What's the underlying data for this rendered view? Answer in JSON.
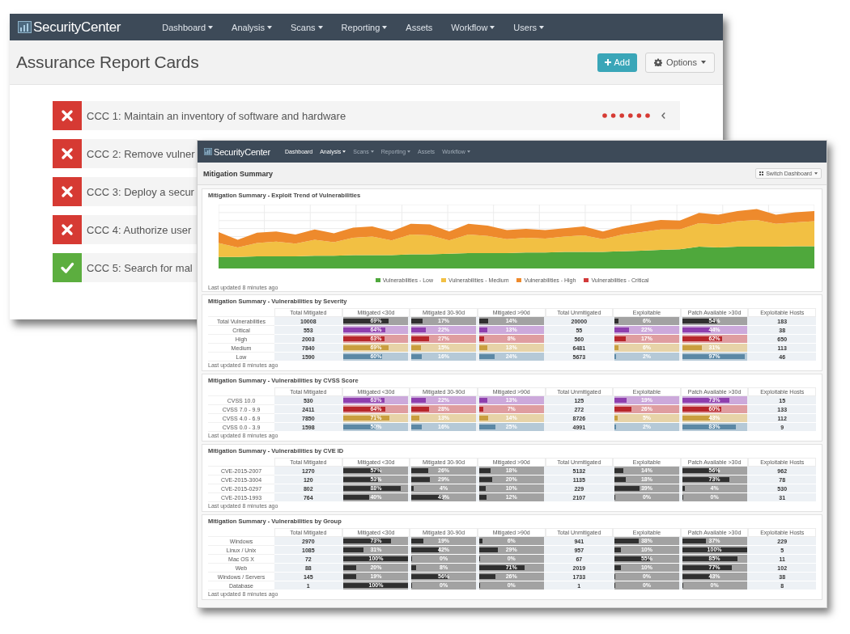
{
  "back_window": {
    "logo": "SecurityCenter",
    "nav": [
      {
        "label": "Dashboard",
        "dropdown": true
      },
      {
        "label": "Analysis",
        "dropdown": true
      },
      {
        "label": "Scans",
        "dropdown": true
      },
      {
        "label": "Reporting",
        "dropdown": true
      },
      {
        "label": "Assets",
        "dropdown": false
      },
      {
        "label": "Workflow",
        "dropdown": true
      },
      {
        "label": "Users",
        "dropdown": true
      }
    ],
    "title": "Assurance Report Cards",
    "buttons": [
      {
        "kind": "add",
        "label": "Add"
      },
      {
        "kind": "options",
        "label": "Options"
      }
    ],
    "cards": [
      {
        "passed": false,
        "label": "CCC 1: Maintain an inventory of software and hardware",
        "history": [
          {
            "passed": false
          },
          {
            "passed": false
          },
          {
            "passed": false
          },
          {
            "passed": false
          },
          {
            "passed": false
          },
          {
            "passed": false
          }
        ]
      },
      {
        "passed": false,
        "label": "CCC 2: Remove vulner"
      },
      {
        "passed": false,
        "label": "CCC 3: Deploy a secur"
      },
      {
        "passed": false,
        "label": "CCC 4: Authorize user"
      },
      {
        "passed": true,
        "label": "CCC 5: Search for mal"
      }
    ]
  },
  "front_window": {
    "logo": "SecurityCenter",
    "nav": [
      {
        "label": "Dashboard",
        "dropdown": false,
        "disabled": false
      },
      {
        "label": "Analysis",
        "dropdown": true,
        "disabled": false
      },
      {
        "label": "Scans",
        "dropdown": true,
        "disabled": true
      },
      {
        "label": "Reporting",
        "dropdown": true,
        "disabled": true
      },
      {
        "label": "Assets",
        "dropdown": false,
        "disabled": true
      },
      {
        "label": "Workflow",
        "dropdown": true,
        "disabled": true
      }
    ],
    "title": "Mitigation Summary",
    "switch_button": "Switch Dashboard",
    "trend_panel": {
      "title": "Mitigation Summary - Exploit Trend of Vulnerabilities",
      "legend": [
        {
          "label": "Vulnerabilities - Low",
          "color": "#4fa83c"
        },
        {
          "label": "Vulnerabilities - Medium",
          "color": "#f2c043"
        },
        {
          "label": "Vulnerabilities - High",
          "color": "#ee8a2c"
        },
        {
          "label": "Vulnerabilities - Critical",
          "color": "#d23a3a"
        }
      ],
      "footer": "Last updated 8 minutes ago"
    },
    "tables": [
      {
        "title": "Mitigation Summary - Vulnerabilities by Severity",
        "columns": [
          {
            "label": "Total Mitigated",
            "kind": "number"
          },
          {
            "label": "Mitigated <30d",
            "kind": "bar"
          },
          {
            "label": "Mitigated 30-90d",
            "kind": "bar"
          },
          {
            "label": "Mitigated >90d",
            "kind": "bar"
          },
          {
            "label": "Total Unmitigated",
            "kind": "number"
          },
          {
            "label": "Exploitable",
            "kind": "bar"
          },
          {
            "label": "Patch Available >30d",
            "kind": "bar"
          },
          {
            "label": "Exploitable Hosts",
            "kind": "number"
          }
        ],
        "rows": [
          {
            "label": "Total Vulnerabilities",
            "color": "#303030",
            "cells": [
              {
                "text": "10008"
              },
              {
                "text": "69%",
                "level": 0.69
              },
              {
                "text": "17%",
                "level": 0.17
              },
              {
                "text": "14%",
                "level": 0.14
              },
              {
                "text": "20000"
              },
              {
                "text": "6%",
                "level": 0.06
              },
              {
                "text": "54%",
                "level": 0.54
              },
              {
                "text": "183"
              }
            ]
          },
          {
            "label": "Critical",
            "color": "#8e3fae",
            "cells": [
              {
                "text": "553"
              },
              {
                "text": "64%",
                "level": 0.64
              },
              {
                "text": "22%",
                "level": 0.22
              },
              {
                "text": "13%",
                "level": 0.13
              },
              {
                "text": "55"
              },
              {
                "text": "22%",
                "level": 0.22
              },
              {
                "text": "44%",
                "level": 0.44
              },
              {
                "text": "38"
              }
            ]
          },
          {
            "label": "High",
            "color": "#b8262b",
            "cells": [
              {
                "text": "2003"
              },
              {
                "text": "63%",
                "level": 0.63
              },
              {
                "text": "27%",
                "level": 0.27
              },
              {
                "text": "8%",
                "level": 0.08
              },
              {
                "text": "560"
              },
              {
                "text": "17%",
                "level": 0.17
              },
              {
                "text": "62%",
                "level": 0.62
              },
              {
                "text": "650"
              }
            ]
          },
          {
            "label": "Medium",
            "color": "#c99e3e",
            "cells": [
              {
                "text": "7840"
              },
              {
                "text": "69%",
                "level": 0.69
              },
              {
                "text": "15%",
                "level": 0.15
              },
              {
                "text": "13%",
                "level": 0.13
              },
              {
                "text": "6481"
              },
              {
                "text": "6%",
                "level": 0.06
              },
              {
                "text": "31%",
                "level": 0.31
              },
              {
                "text": "113"
              }
            ]
          },
          {
            "label": "Low",
            "color": "#5b88a5",
            "cells": [
              {
                "text": "1590"
              },
              {
                "text": "60%",
                "level": 0.6
              },
              {
                "text": "16%",
                "level": 0.16
              },
              {
                "text": "24%",
                "level": 0.24
              },
              {
                "text": "5673"
              },
              {
                "text": "2%",
                "level": 0.02
              },
              {
                "text": "97%",
                "level": 0.97
              },
              {
                "text": "46"
              }
            ]
          }
        ],
        "footer": "Last updated 8 minutes ago"
      },
      {
        "title": "Mitigation Summary - Vulnerabilities by CVSS Score",
        "columns": [
          {
            "label": "Total Mitigated",
            "kind": "number"
          },
          {
            "label": "Mitigated <30d",
            "kind": "bar"
          },
          {
            "label": "Mitigated 30-90d",
            "kind": "bar"
          },
          {
            "label": "Mitigated >90d",
            "kind": "bar"
          },
          {
            "label": "Total Unmitigated",
            "kind": "number"
          },
          {
            "label": "Exploitable",
            "kind": "bar"
          },
          {
            "label": "Patch Available >30d",
            "kind": "bar"
          },
          {
            "label": "Exploitable Hosts",
            "kind": "number"
          }
        ],
        "rows": [
          {
            "label": "CVSS 10.0",
            "color": "#8e3fae",
            "cells": [
              {
                "text": "530"
              },
              {
                "text": "63%",
                "level": 0.63
              },
              {
                "text": "22%",
                "level": 0.22
              },
              {
                "text": "13%",
                "level": 0.13
              },
              {
                "text": "125"
              },
              {
                "text": "19%",
                "level": 0.19
              },
              {
                "text": "73%",
                "level": 0.73
              },
              {
                "text": "15"
              }
            ]
          },
          {
            "label": "CVSS 7.0 - 9.9",
            "color": "#b8262b",
            "cells": [
              {
                "text": "2411"
              },
              {
                "text": "64%",
                "level": 0.64
              },
              {
                "text": "28%",
                "level": 0.28
              },
              {
                "text": "7%",
                "level": 0.07
              },
              {
                "text": "272"
              },
              {
                "text": "26%",
                "level": 0.26
              },
              {
                "text": "60%",
                "level": 0.6
              },
              {
                "text": "133"
              }
            ]
          },
          {
            "label": "CVSS 4.0 - 6.9",
            "color": "#c99e3e",
            "cells": [
              {
                "text": "7850"
              },
              {
                "text": "71%",
                "level": 0.71
              },
              {
                "text": "13%",
                "level": 0.13
              },
              {
                "text": "14%",
                "level": 0.14
              },
              {
                "text": "8726"
              },
              {
                "text": "5%",
                "level": 0.05
              },
              {
                "text": "43%",
                "level": 0.43
              },
              {
                "text": "112"
              }
            ]
          },
          {
            "label": "CVSS 0.0 - 3.9",
            "color": "#5b88a5",
            "cells": [
              {
                "text": "1598"
              },
              {
                "text": "50%",
                "level": 0.5
              },
              {
                "text": "16%",
                "level": 0.16
              },
              {
                "text": "25%",
                "level": 0.25
              },
              {
                "text": "4991"
              },
              {
                "text": "2%",
                "level": 0.02
              },
              {
                "text": "83%",
                "level": 0.83
              },
              {
                "text": "9"
              }
            ]
          }
        ],
        "footer": "Last updated 8 minutes ago"
      },
      {
        "title": "Mitigation Summary - Vulnerabilities by CVE ID",
        "columns": [
          {
            "label": "Total Mitigated",
            "kind": "number"
          },
          {
            "label": "Mitigated <30d",
            "kind": "bar"
          },
          {
            "label": "Mitigated 30-90d",
            "kind": "bar"
          },
          {
            "label": "Mitigated >90d",
            "kind": "bar"
          },
          {
            "label": "Total Unmitigated",
            "kind": "number"
          },
          {
            "label": "Exploitable",
            "kind": "bar"
          },
          {
            "label": "Patch Available >30d",
            "kind": "bar"
          },
          {
            "label": "Exploitable Hosts",
            "kind": "number"
          }
        ],
        "rows": [
          {
            "label": "CVE-2015-2007",
            "cells": [
              {
                "text": "1270"
              },
              {
                "text": "57%",
                "level": 0.57
              },
              {
                "text": "26%",
                "level": 0.26
              },
              {
                "text": "18%",
                "level": 0.18
              },
              {
                "text": "5132"
              },
              {
                "text": "14%",
                "level": 0.14
              },
              {
                "text": "56%",
                "level": 0.56
              },
              {
                "text": "962"
              }
            ]
          },
          {
            "label": "CVE-2015-3004",
            "cells": [
              {
                "text": "120"
              },
              {
                "text": "53%",
                "level": 0.53
              },
              {
                "text": "29%",
                "level": 0.29
              },
              {
                "text": "20%",
                "level": 0.2
              },
              {
                "text": "1135"
              },
              {
                "text": "18%",
                "level": 0.18
              },
              {
                "text": "73%",
                "level": 0.73
              },
              {
                "text": "78"
              }
            ]
          },
          {
            "label": "CVE-2015-0297",
            "cells": [
              {
                "text": "802"
              },
              {
                "text": "88%",
                "level": 0.88
              },
              {
                "text": "4%",
                "level": 0.04
              },
              {
                "text": "10%",
                "level": 0.1
              },
              {
                "text": "229"
              },
              {
                "text": "39%",
                "level": 0.39
              },
              {
                "text": "4%",
                "level": 0.04
              },
              {
                "text": "530"
              }
            ]
          },
          {
            "label": "CVE-2015-1993",
            "cells": [
              {
                "text": "764"
              },
              {
                "text": "40%",
                "level": 0.4
              },
              {
                "text": "49%",
                "level": 0.49
              },
              {
                "text": "12%",
                "level": 0.12
              },
              {
                "text": "2107"
              },
              {
                "text": "0%",
                "level": 0
              },
              {
                "text": "0%",
                "level": 0
              },
              {
                "text": "31"
              }
            ]
          }
        ],
        "footer": "Last updated 8 minutes ago"
      },
      {
        "title": "Mitigation Summary - Vulnerabilities by Group",
        "columns": [
          {
            "label": "Total Mitigated",
            "kind": "number"
          },
          {
            "label": "Mitigated <30d",
            "kind": "bar"
          },
          {
            "label": "Mitigated 30-90d",
            "kind": "bar"
          },
          {
            "label": "Mitigated >90d",
            "kind": "bar"
          },
          {
            "label": "Total Unmitigated",
            "kind": "number"
          },
          {
            "label": "Exploitable",
            "kind": "bar"
          },
          {
            "label": "Patch Available >30d",
            "kind": "bar"
          },
          {
            "label": "Exploitable Hosts",
            "kind": "number"
          }
        ],
        "rows": [
          {
            "label": "Windows",
            "cells": [
              {
                "text": "2970"
              },
              {
                "text": "73%",
                "level": 0.73
              },
              {
                "text": "19%",
                "level": 0.19
              },
              {
                "text": "6%",
                "level": 0.06
              },
              {
                "text": "941"
              },
              {
                "text": "38%",
                "level": 0.38
              },
              {
                "text": "37%",
                "level": 0.37
              },
              {
                "text": "229"
              }
            ]
          },
          {
            "label": "Linux / Unix",
            "cells": [
              {
                "text": "1085"
              },
              {
                "text": "31%",
                "level": 0.31
              },
              {
                "text": "42%",
                "level": 0.42
              },
              {
                "text": "29%",
                "level": 0.29
              },
              {
                "text": "957"
              },
              {
                "text": "10%",
                "level": 0.1
              },
              {
                "text": "100%",
                "level": 1
              },
              {
                "text": "5"
              }
            ]
          },
          {
            "label": "Mac OS X",
            "cells": [
              {
                "text": "72"
              },
              {
                "text": "100%",
                "level": 1
              },
              {
                "text": "0%",
                "level": 0
              },
              {
                "text": "0%",
                "level": 0
              },
              {
                "text": "67"
              },
              {
                "text": "55%",
                "level": 0.55
              },
              {
                "text": "85%",
                "level": 0.85
              },
              {
                "text": "11"
              }
            ]
          },
          {
            "label": "Web",
            "cells": [
              {
                "text": "88"
              },
              {
                "text": "20%",
                "level": 0.2
              },
              {
                "text": "8%",
                "level": 0.08
              },
              {
                "text": "71%",
                "level": 0.71
              },
              {
                "text": "2019"
              },
              {
                "text": "10%",
                "level": 0.1
              },
              {
                "text": "77%",
                "level": 0.77
              },
              {
                "text": "102"
              }
            ]
          },
          {
            "label": "Windows / Servers",
            "cells": [
              {
                "text": "145"
              },
              {
                "text": "19%",
                "level": 0.19
              },
              {
                "text": "56%",
                "level": 0.56
              },
              {
                "text": "26%",
                "level": 0.26
              },
              {
                "text": "1733"
              },
              {
                "text": "0%",
                "level": 0
              },
              {
                "text": "43%",
                "level": 0.43
              },
              {
                "text": "38"
              }
            ]
          },
          {
            "label": "Database",
            "cells": [
              {
                "text": "1"
              },
              {
                "text": "100%",
                "level": 1
              },
              {
                "text": "0%",
                "level": 0
              },
              {
                "text": "0%",
                "level": 0
              },
              {
                "text": "1"
              },
              {
                "text": "0%",
                "level": 0
              },
              {
                "text": "0%",
                "level": 0
              },
              {
                "text": "8"
              }
            ]
          }
        ],
        "footer": "Last updated 8 minutes ago"
      }
    ]
  }
}
